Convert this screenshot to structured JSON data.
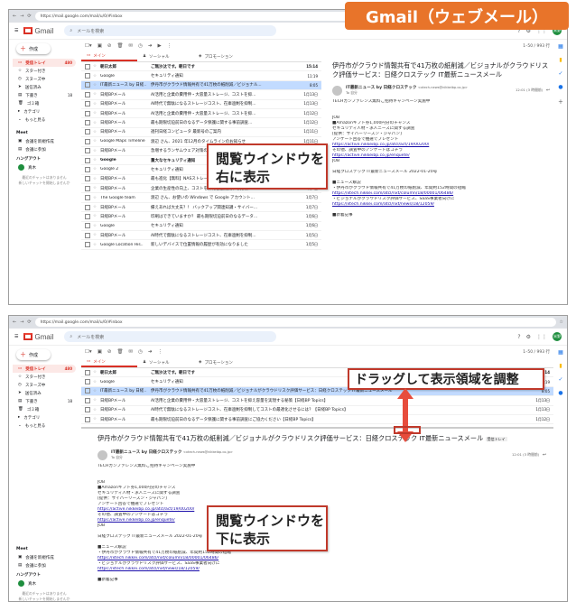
{
  "banner_title": "Gmail（ウェブメール）",
  "browser": {
    "url": "https://mail.google.com/mail/u/0/#inbox"
  },
  "gmail": {
    "logo": "Gmail",
    "search_placeholder": "メールを検索",
    "avatar": "米野",
    "compose": "作成",
    "nav": [
      {
        "label": "受信トレイ",
        "count": "480"
      },
      {
        "label": "スター付き",
        "count": ""
      },
      {
        "label": "スヌーズ中",
        "count": ""
      },
      {
        "label": "送信済み",
        "count": ""
      },
      {
        "label": "下書き",
        "count": "18"
      },
      {
        "label": "ゴミ箱",
        "count": ""
      },
      {
        "label": "カテゴリ",
        "count": ""
      },
      {
        "label": "もっと見る",
        "count": ""
      }
    ],
    "meet": {
      "title": "Meet",
      "items": [
        "会議を新規作成",
        "会議に参加"
      ]
    },
    "hangouts": {
      "title": "ハングアウト",
      "user": "真木",
      "note1": "最近のチャットはありません",
      "note2": "新しいチャットを開始しませんか"
    },
    "pager": "1–50 / 993 行",
    "tabs": [
      "メイン",
      "ソーシャル",
      "プロモーション"
    ]
  },
  "rows_top": [
    {
      "sender": "朝日太郎",
      "subject": "ご無沙汰です。朝日です",
      "date": "15:14",
      "unread": true,
      "selected": false
    },
    {
      "sender": "Google",
      "subject": "セキュリティ通知",
      "date": "11:19",
      "unread": false,
      "selected": false
    },
    {
      "sender": "IT最新ニュース by 日経..",
      "subject": "伊丹市がクラウド情報共有で41万枚の紙削減／ビジョナル...",
      "date": "8:05",
      "unread": false,
      "selected": true
    },
    {
      "sender": "日経BPメール",
      "subject": "AI活用と企業の費用伸・大容量ストレージ、コストを抑...",
      "date": "1月13日",
      "unread": false,
      "selected": false
    },
    {
      "sender": "日経BPメール",
      "subject": "AI時代で無駄になるストレージコスト、在庫過剰を抑制...",
      "date": "1月13日",
      "unread": false,
      "selected": false
    },
    {
      "sender": "日経BPメール",
      "subject": "AI活用と企業の費用伸・大容量ストレージ、コストを抑...",
      "date": "1月12日",
      "unread": false,
      "selected": false
    },
    {
      "sender": "日経BPメール",
      "subject": "最も期限切迫前日のなるデータ保護に関する事前調査...",
      "date": "1月12日",
      "unread": false,
      "selected": false
    },
    {
      "sender": "日経BPメール",
      "subject": "週刊日経コンピュータ 最新号のご案内",
      "date": "1月11日",
      "unread": false,
      "selected": false
    },
    {
      "sender": "Google Maps Timeline",
      "subject": "渡辺 さん、2021 年12月のタイムラインのお知らせ",
      "date": "1月11日",
      "unread": false,
      "selected": false
    },
    {
      "sender": "日経BPメール",
      "subject": "急増するランサムウェア対策の最新動向",
      "date": "1月10日",
      "unread": false,
      "selected": false
    },
    {
      "sender": "Google",
      "subject": "重大なセキュリティ通知",
      "date": "1月10日",
      "unread": true,
      "selected": false
    },
    {
      "sender": "Google 2",
      "subject": "セキュリティ通知",
      "date": "1月8日",
      "unread": false,
      "selected": false
    },
    {
      "sender": "日経BPメール",
      "subject": "最も進化【無料】NASストレージ、性能を確保して容量...",
      "date": "1月8日",
      "unread": false,
      "selected": false
    },
    {
      "sender": "日経BPメール",
      "subject": "企業の生産性の向上、コストを抑え容量削減する方法...",
      "date": "1月7日",
      "unread": false,
      "selected": false
    },
    {
      "sender": "The Google team",
      "subject": "渡辺 さん、お使いの Windows で Google アカウント...",
      "date": "1月7日",
      "unread": false,
      "selected": false
    },
    {
      "sender": "日経BPメール",
      "subject": "備えあれば大丈夫？！ バックアップ関連知識・サイバー...",
      "date": "1月7日",
      "unread": false,
      "selected": false
    },
    {
      "sender": "日経BPメール",
      "subject": "印刷はできていますか？ 最も期限切迫前日のなるデータ...",
      "date": "1月6日",
      "unread": false,
      "selected": false
    },
    {
      "sender": "Google",
      "subject": "セキュリティ通知",
      "date": "1月6日",
      "unread": false,
      "selected": false
    },
    {
      "sender": "日経BPメール",
      "subject": "AI時代で無駄になるストレージコスト、在庫過剰を抑制...",
      "date": "1月5日",
      "unread": false,
      "selected": false
    },
    {
      "sender": "Google Location His..",
      "subject": "新しいデバイスで位置情報の履歴が有効になりました",
      "date": "1月5日",
      "unread": false,
      "selected": false
    }
  ],
  "rows_bottom": [
    {
      "sender": "朝日太郎",
      "subject": "ご無沙汰です。朝日です",
      "date": "15:14",
      "unread": true,
      "selected": false
    },
    {
      "sender": "Google",
      "subject": "セキュリティ通知",
      "date": "11:19",
      "unread": false,
      "selected": false
    },
    {
      "sender": "IT最新ニュース by 日経..",
      "subject": "伊丹市がクラウド情報共有で41万枚の紙削減／ビジョナルがクラウドリスク評価サービス：日経クロステック IT最新ニュースメール",
      "date": "8:05",
      "unread": false,
      "selected": true
    },
    {
      "sender": "日経BPメール",
      "subject": "AI活用と企業の費用伸・大容量ストレージ、コストを抑え容量を実現する秘策【日経BP Topics】",
      "date": "1月13日",
      "unread": false,
      "selected": false
    },
    {
      "sender": "日経BPメール",
      "subject": "AI時代で無駄になるストレージコスト、在庫過剰を抑制してコストの最適化させるには？【日経BP Topics】",
      "date": "1月13日",
      "unread": false,
      "selected": false
    },
    {
      "sender": "日経BPメール",
      "subject": "最も期限切迫前日のなるデータ保護に関する事前調査にご協力ください【日経BP Topics】",
      "date": "1月12日",
      "unread": false,
      "selected": false
    }
  ],
  "email": {
    "title": "伊丹市がクラウド情報共有で41万枚の紙削減／ビジョナルがクラウドリスク評価サービス：日経クロステック IT最新ニュースメール",
    "label": "受信トレイ",
    "from": "IT最新ニュース by 日経クロステック",
    "address": "<xtech-news@nikkeibp.co.jp>",
    "to": "To 自分",
    "date": "12:01 (3 時間前)",
    "lines": [
      "TECHカンファレンス無料ご招待キャンペーン実施中",
      "",
      "",
      "JOB",
      "■Amazonギフト券1,000円分のチャンス",
      "セキュリティ人材・求人ニーズに関する調査",
      "[提供：サイバーリーズン・ジャパン]",
      "アンケート回答で抽選でプレゼント",
      "https://active.nikkeibp.co.jp/atcl/act/19/00200/",
      "その他、調査中のアンケートはコチラ",
      "https://active.nikkeibp.co.jp/enquete/",
      "JOB",
      "",
      "日経クロステック IT最新ニュースメール 2022-01-20号",
      "",
      "■ニュース解説",
      "・伊丹市がクラウド情報共有で41万枚の紙削減、年間約152時間の短縮",
      "https://xtech.nikkei.com/atcl/nxt/column/18/00001/06486/",
      "・ビジョナルがクラウドリスク評価サービス、SaaS事業者向けに",
      "https://xtech.nikkei.com/atcl/nxt/news/18/12059/",
      "",
      "■新着記事"
    ]
  },
  "callouts": {
    "right1": "閲覧ウインドウを",
    "right2": "右に表示",
    "down1": "閲覧ウインドウを",
    "down2": "下に表示",
    "drag": "ドラッグして表示領域を調整"
  }
}
